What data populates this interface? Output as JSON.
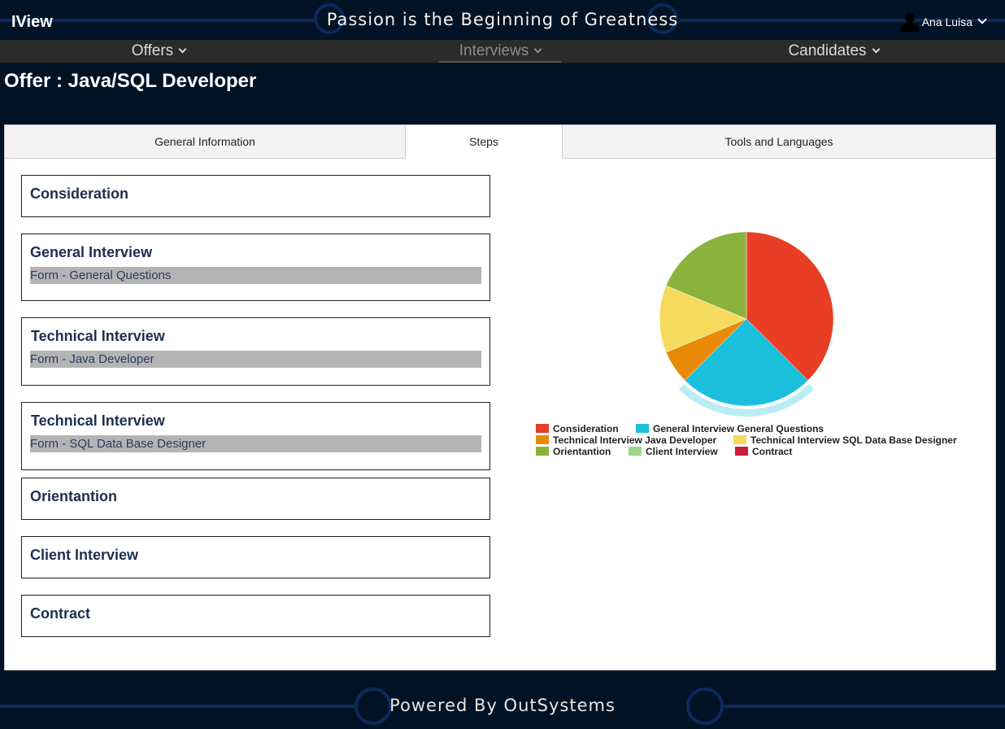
{
  "header": {
    "app_title": "IView",
    "tagline": "Passion is the Beginning of Greatness",
    "user_name": "Ana Luisa"
  },
  "nav": {
    "items": [
      {
        "label": "Offers"
      },
      {
        "label": "Interviews"
      },
      {
        "label": "Candidates"
      }
    ],
    "active": "Interviews"
  },
  "page": {
    "title": "Offer : Java/SQL Developer"
  },
  "tabs": [
    {
      "label": "General Information"
    },
    {
      "label": "Steps"
    },
    {
      "label": "Tools and Languages"
    }
  ],
  "active_tab": "Steps",
  "steps": [
    {
      "title": "Consideration",
      "form": ""
    },
    {
      "title": "General Interview",
      "form": "Form - General Questions"
    },
    {
      "title": "Technical Interview",
      "form": "Form - Java Developer"
    },
    {
      "title": "Technical Interview",
      "form": "Form - SQL Data Base Designer"
    },
    {
      "title": "Orientantion",
      "form": ""
    },
    {
      "title": "Client Interview",
      "form": ""
    },
    {
      "title": "Contract",
      "form": ""
    }
  ],
  "chart_data": {
    "type": "pie",
    "title": "",
    "labels": [
      "Consideration",
      "General Interview General Questions",
      "Technical Interview Java Developer",
      "Technical Interview SQL Data Base Designer",
      "Orientantion",
      "Client Interview",
      "Contract"
    ],
    "values": [
      37.5,
      25,
      6.25,
      12.5,
      18.75,
      0,
      0
    ],
    "colors": [
      "#e83e26",
      "#1bbfdc",
      "#e88a06",
      "#f5da5e",
      "#8bb23c",
      "#9fd58a",
      "#cc1c3c"
    ],
    "highlighted": "General Interview General Questions",
    "legend_position": "bottom"
  },
  "footer": {
    "text": "Powered By OutSystems"
  },
  "colors": {
    "background": "#001224",
    "nav_bar": "#2b2b2b",
    "step_title": "#1d2f52",
    "form_bar": "#b5b4b4"
  }
}
